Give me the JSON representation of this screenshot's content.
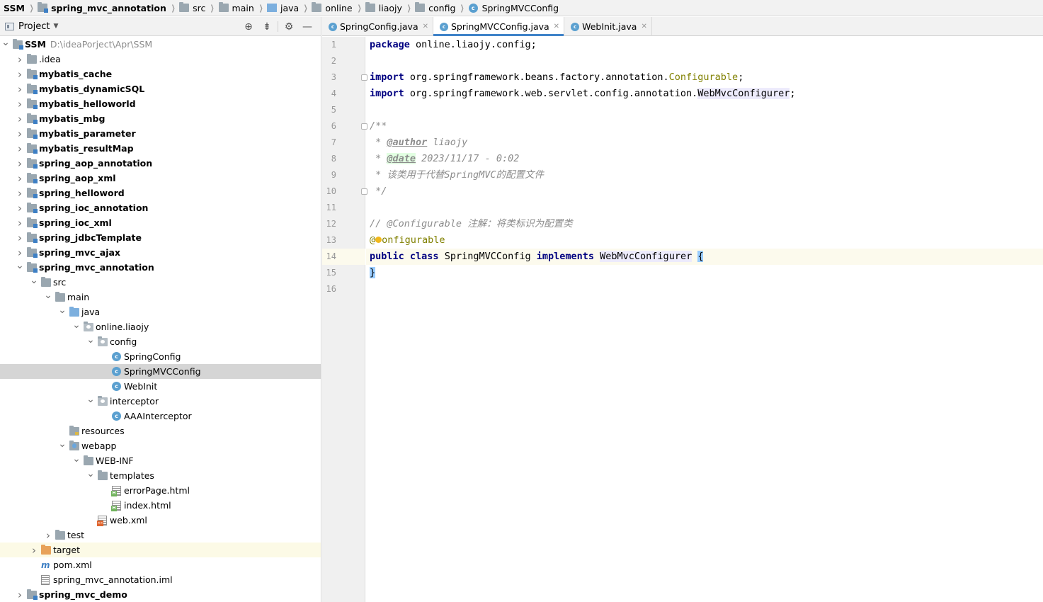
{
  "breadcrumb": [
    {
      "label": "SSM",
      "bold": true,
      "icon": "none"
    },
    {
      "label": "spring_mvc_annotation",
      "bold": true,
      "icon": "module-folder-icon"
    },
    {
      "label": "src",
      "bold": false,
      "icon": "folder-icon"
    },
    {
      "label": "main",
      "bold": false,
      "icon": "folder-icon"
    },
    {
      "label": "java",
      "bold": false,
      "icon": "source-folder-icon"
    },
    {
      "label": "online",
      "bold": false,
      "icon": "folder-icon"
    },
    {
      "label": "liaojy",
      "bold": false,
      "icon": "folder-icon"
    },
    {
      "label": "config",
      "bold": false,
      "icon": "folder-icon"
    },
    {
      "label": "SpringMVCConfig",
      "bold": false,
      "icon": "class-icon"
    }
  ],
  "project_panel": {
    "title": "Project",
    "tools": [
      "locate-icon",
      "collapse-icon",
      "gear-icon",
      "minimize-icon"
    ]
  },
  "tree": [
    {
      "label": "SSM",
      "path": "D:\\ideaPorject\\Apr\\SSM",
      "depth": 0,
      "arrow": "open",
      "icon": "module",
      "bold": true
    },
    {
      "label": ".idea",
      "depth": 1,
      "arrow": "closed",
      "icon": "folder",
      "bold": false
    },
    {
      "label": "mybatis_cache",
      "depth": 1,
      "arrow": "closed",
      "icon": "module",
      "bold": true
    },
    {
      "label": "mybatis_dynamicSQL",
      "depth": 1,
      "arrow": "closed",
      "icon": "module",
      "bold": true
    },
    {
      "label": "mybatis_helloworld",
      "depth": 1,
      "arrow": "closed",
      "icon": "module",
      "bold": true
    },
    {
      "label": "mybatis_mbg",
      "depth": 1,
      "arrow": "closed",
      "icon": "module",
      "bold": true
    },
    {
      "label": "mybatis_parameter",
      "depth": 1,
      "arrow": "closed",
      "icon": "module",
      "bold": true
    },
    {
      "label": "mybatis_resultMap",
      "depth": 1,
      "arrow": "closed",
      "icon": "module",
      "bold": true
    },
    {
      "label": "spring_aop_annotation",
      "depth": 1,
      "arrow": "closed",
      "icon": "module",
      "bold": true
    },
    {
      "label": "spring_aop_xml",
      "depth": 1,
      "arrow": "closed",
      "icon": "module",
      "bold": true
    },
    {
      "label": "spring_helloword",
      "depth": 1,
      "arrow": "closed",
      "icon": "module",
      "bold": true
    },
    {
      "label": "spring_ioc_annotation",
      "depth": 1,
      "arrow": "closed",
      "icon": "module",
      "bold": true
    },
    {
      "label": "spring_ioc_xml",
      "depth": 1,
      "arrow": "closed",
      "icon": "module",
      "bold": true
    },
    {
      "label": "spring_jdbcTemplate",
      "depth": 1,
      "arrow": "closed",
      "icon": "module",
      "bold": true
    },
    {
      "label": "spring_mvc_ajax",
      "depth": 1,
      "arrow": "closed",
      "icon": "module",
      "bold": true
    },
    {
      "label": "spring_mvc_annotation",
      "depth": 1,
      "arrow": "open",
      "icon": "module",
      "bold": true
    },
    {
      "label": "src",
      "depth": 2,
      "arrow": "open",
      "icon": "folder",
      "bold": false
    },
    {
      "label": "main",
      "depth": 3,
      "arrow": "open",
      "icon": "folder",
      "bold": false
    },
    {
      "label": "java",
      "depth": 4,
      "arrow": "open",
      "icon": "src",
      "bold": false
    },
    {
      "label": "online.liaojy",
      "depth": 5,
      "arrow": "open",
      "icon": "pkg",
      "bold": false
    },
    {
      "label": "config",
      "depth": 6,
      "arrow": "open",
      "icon": "pkg",
      "bold": false
    },
    {
      "label": "SpringConfig",
      "depth": 7,
      "arrow": "none",
      "icon": "class",
      "bold": false
    },
    {
      "label": "SpringMVCConfig",
      "depth": 7,
      "arrow": "none",
      "icon": "class",
      "bold": false,
      "selected": true
    },
    {
      "label": "WebInit",
      "depth": 7,
      "arrow": "none",
      "icon": "class",
      "bold": false
    },
    {
      "label": "interceptor",
      "depth": 6,
      "arrow": "open",
      "icon": "pkg",
      "bold": false
    },
    {
      "label": "AAAInterceptor",
      "depth": 7,
      "arrow": "none",
      "icon": "class",
      "bold": false
    },
    {
      "label": "resources",
      "depth": 4,
      "arrow": "none",
      "icon": "res",
      "bold": false
    },
    {
      "label": "webapp",
      "depth": 4,
      "arrow": "open",
      "icon": "web",
      "bold": false
    },
    {
      "label": "WEB-INF",
      "depth": 5,
      "arrow": "open",
      "icon": "folder",
      "bold": false
    },
    {
      "label": "templates",
      "depth": 6,
      "arrow": "open",
      "icon": "folder",
      "bold": false
    },
    {
      "label": "errorPage.html",
      "depth": 7,
      "arrow": "none",
      "icon": "html",
      "bold": false
    },
    {
      "label": "index.html",
      "depth": 7,
      "arrow": "none",
      "icon": "html",
      "bold": false
    },
    {
      "label": "web.xml",
      "depth": 6,
      "arrow": "none",
      "icon": "xml",
      "bold": false
    },
    {
      "label": "test",
      "depth": 3,
      "arrow": "closed",
      "icon": "folder",
      "bold": false
    },
    {
      "label": "target",
      "depth": 2,
      "arrow": "closed",
      "icon": "target",
      "bold": false,
      "highlight": true
    },
    {
      "label": "pom.xml",
      "depth": 2,
      "arrow": "none",
      "icon": "maven",
      "bold": false
    },
    {
      "label": "spring_mvc_annotation.iml",
      "depth": 2,
      "arrow": "none",
      "icon": "iml",
      "bold": false
    },
    {
      "label": "spring_mvc_demo",
      "depth": 1,
      "arrow": "closed",
      "icon": "module",
      "bold": true
    }
  ],
  "tabs": [
    {
      "label": "SpringConfig.java",
      "active": false
    },
    {
      "label": "SpringMVCConfig.java",
      "active": true
    },
    {
      "label": "WebInit.java",
      "active": false
    }
  ],
  "editor": {
    "current_line": 14,
    "lines": [
      {
        "n": "1",
        "tokens": [
          [
            "kw",
            "package"
          ],
          [
            "pl",
            " online.liaojy.config;"
          ]
        ]
      },
      {
        "n": "2",
        "tokens": []
      },
      {
        "n": "3",
        "fold": true,
        "tokens": [
          [
            "kw",
            "import"
          ],
          [
            "pl",
            " org.springframework.beans.factory.annotation."
          ],
          [
            "ann",
            "Configurable"
          ],
          [
            "pl",
            ";"
          ]
        ]
      },
      {
        "n": "4",
        "tokens": [
          [
            "kw",
            "import"
          ],
          [
            "pl",
            " org.springframework.web.servlet.config.annotation."
          ],
          [
            "hl",
            "WebMvcConfigurer"
          ],
          [
            "pl",
            ";"
          ]
        ]
      },
      {
        "n": "5",
        "tokens": []
      },
      {
        "n": "6",
        "fold": true,
        "tokens": [
          [
            "cmt",
            "/**"
          ]
        ]
      },
      {
        "n": "7",
        "tokens": [
          [
            "cmt",
            " * "
          ],
          [
            "tag",
            "@author"
          ],
          [
            "cmt",
            " liaojy"
          ]
        ]
      },
      {
        "n": "8",
        "tokens": [
          [
            "cmt",
            " * "
          ],
          [
            "tagbg",
            "@date"
          ],
          [
            "cmt",
            " 2023/11/17 - 0:02"
          ]
        ]
      },
      {
        "n": "9",
        "tokens": [
          [
            "cmt",
            " * 该类用于代替SpringMVC的配置文件"
          ]
        ]
      },
      {
        "n": "10",
        "fold": true,
        "tokens": [
          [
            "cmt",
            " */"
          ]
        ]
      },
      {
        "n": "11",
        "tokens": []
      },
      {
        "n": "12",
        "tokens": [
          [
            "cmt",
            "// @Configurable 注解：将类标识为配置类"
          ]
        ]
      },
      {
        "n": "13",
        "tokens": [
          [
            "ann",
            "@"
          ],
          [
            "bulb",
            ""
          ],
          [
            "ann",
            "onfigurable"
          ]
        ]
      },
      {
        "n": "14",
        "tokens": [
          [
            "kw",
            "public"
          ],
          [
            "pl",
            " "
          ],
          [
            "kw",
            "class"
          ],
          [
            "pl",
            " SpringMVCConfig "
          ],
          [
            "kw",
            "implements"
          ],
          [
            "pl",
            " "
          ],
          [
            "hl",
            "WebMvcConfigurer"
          ],
          [
            "pl",
            " "
          ],
          [
            "brace",
            "{"
          ]
        ]
      },
      {
        "n": "15",
        "tokens": [
          [
            "brace",
            "}"
          ]
        ]
      },
      {
        "n": "16",
        "tokens": []
      }
    ]
  }
}
